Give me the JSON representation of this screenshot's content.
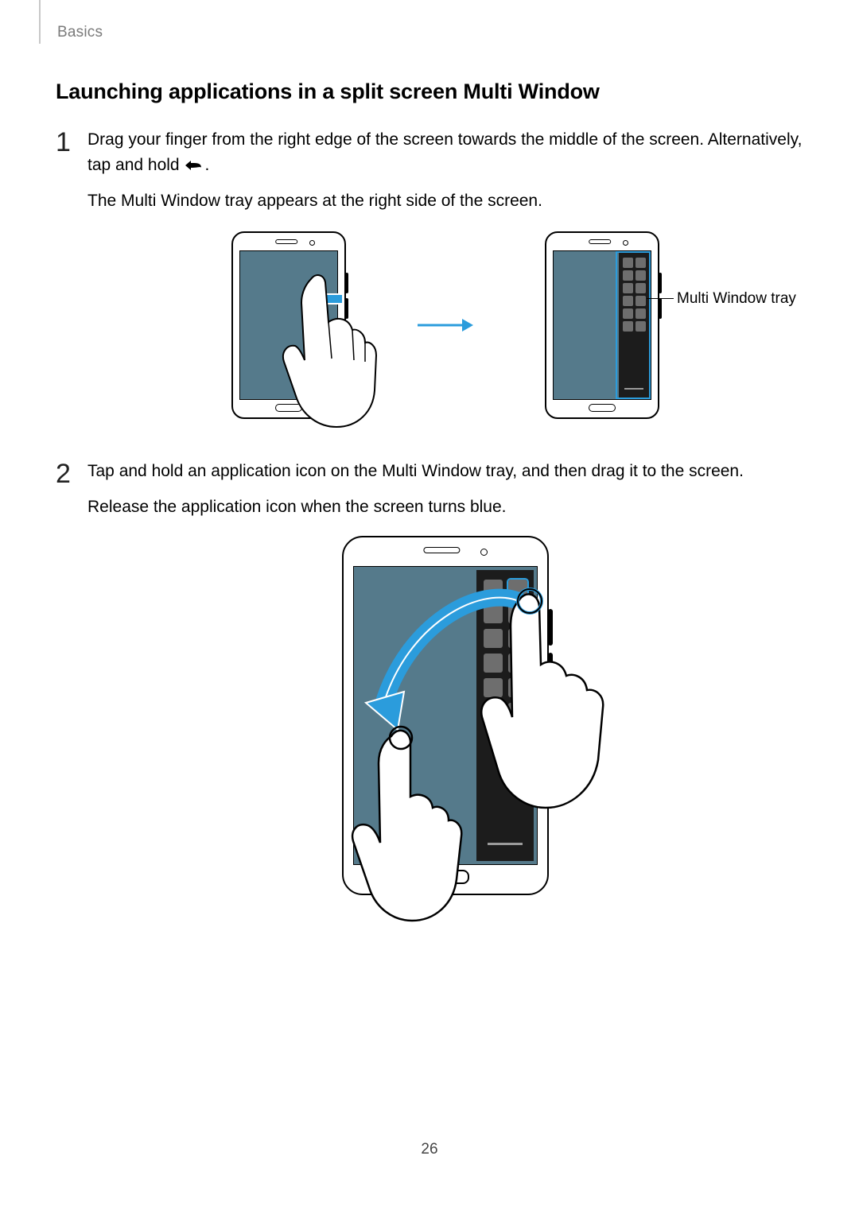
{
  "header": {
    "section": "Basics"
  },
  "title": "Launching applications in a split screen Multi Window",
  "steps": [
    {
      "num": "1",
      "p1a": "Drag your finger from the right edge of the screen towards the middle of the screen. Alternatively, tap and hold ",
      "p1b": ".",
      "p2": "The Multi Window tray appears at the right side of the screen.",
      "callout": "Multi Window tray"
    },
    {
      "num": "2",
      "p1": "Tap and hold an application icon on the Multi Window tray, and then drag it to the screen.",
      "p2": "Release the application icon when the screen turns blue."
    }
  ],
  "page_number": "26"
}
